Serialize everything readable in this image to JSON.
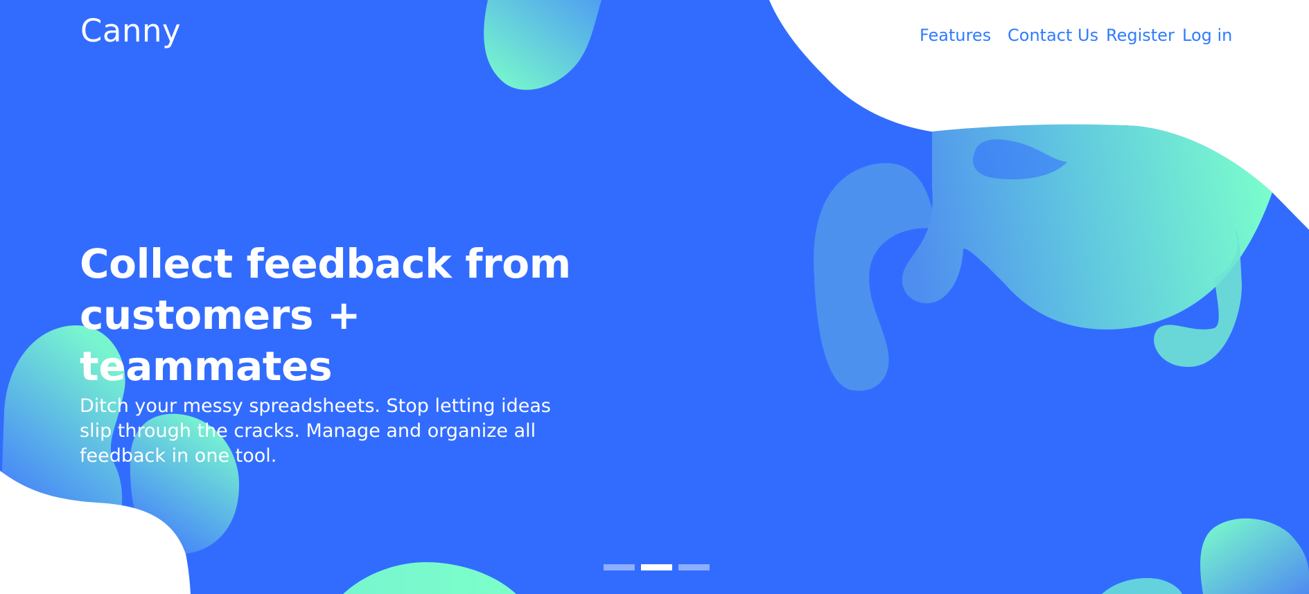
{
  "brand": {
    "logo_text": "Canny"
  },
  "nav": {
    "items": [
      {
        "label": "Features"
      },
      {
        "label": "Contact Us"
      },
      {
        "label": "Register"
      },
      {
        "label": "Log in"
      }
    ]
  },
  "hero": {
    "headline": "Collect feedback from\ncustomers + teammates",
    "subtitle": "Ditch your messy spreadsheets. Stop letting ideas slip through the cracks. Manage and organize all feedback in one tool."
  },
  "carousel": {
    "slides": 3,
    "active_slide": 2
  },
  "colors": {
    "background": "#326cff",
    "link": "#2f7cff",
    "gradient_start": "#4f8bf0",
    "gradient_end": "#7bffc9",
    "text": "#ffffff"
  }
}
